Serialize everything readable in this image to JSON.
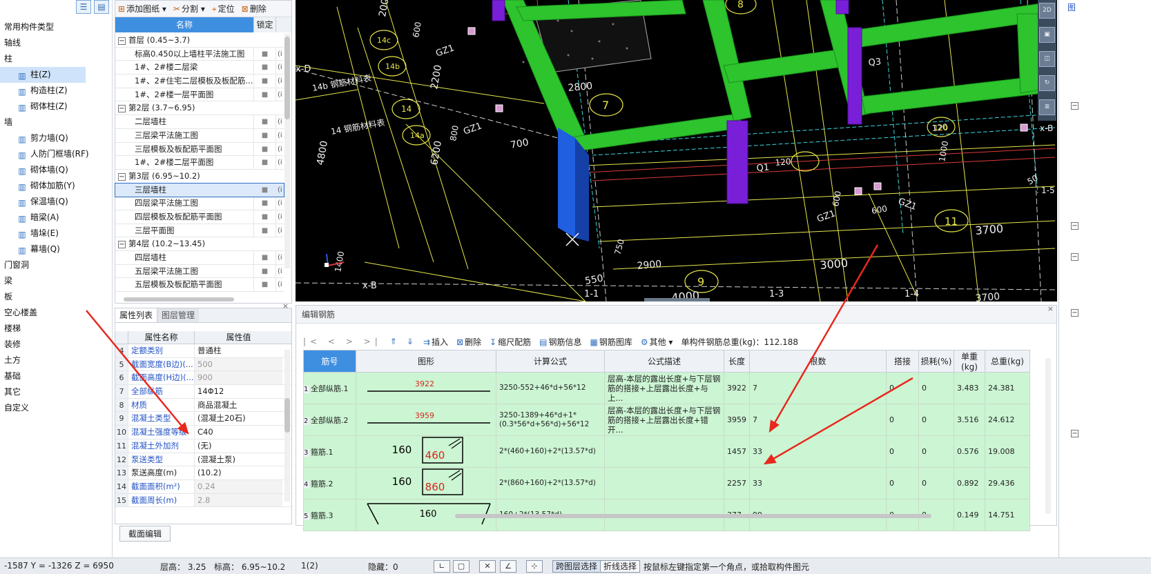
{
  "left_nav": {
    "items": [
      {
        "label": "常用构件类型",
        "type": "cat"
      },
      {
        "label": "轴线",
        "type": "cat"
      },
      {
        "label": "柱",
        "type": "cat"
      },
      {
        "label": "柱(Z)",
        "type": "sub",
        "icon": "column-icon",
        "selected": true
      },
      {
        "label": "构造柱(Z)",
        "type": "sub",
        "icon": "construct-column-icon"
      },
      {
        "label": "砌体柱(Z)",
        "type": "sub",
        "icon": "masonry-column-icon"
      },
      {
        "label": "墙",
        "type": "cat"
      },
      {
        "label": "剪力墙(Q)",
        "type": "sub",
        "icon": "shear-wall-icon"
      },
      {
        "label": "人防门框墙(RF)",
        "type": "sub",
        "icon": "door-frame-wall-icon"
      },
      {
        "label": "砌体墙(Q)",
        "type": "sub",
        "icon": "masonry-wall-icon"
      },
      {
        "label": "砌体加筋(Y)",
        "type": "sub",
        "icon": "masonry-rebar-icon"
      },
      {
        "label": "保温墙(Q)",
        "type": "sub",
        "icon": "insulation-wall-icon"
      },
      {
        "label": "暗梁(A)",
        "type": "sub",
        "icon": "hidden-beam-icon"
      },
      {
        "label": "墙垛(E)",
        "type": "sub",
        "icon": "wall-pier-icon"
      },
      {
        "label": "幕墙(Q)",
        "type": "sub",
        "icon": "curtain-wall-icon"
      },
      {
        "label": "门窗洞",
        "type": "cat"
      },
      {
        "label": "梁",
        "type": "cat"
      },
      {
        "label": "板",
        "type": "cat"
      },
      {
        "label": "空心楼盖",
        "type": "cat"
      },
      {
        "label": "楼梯",
        "type": "cat"
      },
      {
        "label": "装修",
        "type": "cat"
      },
      {
        "label": "土方",
        "type": "cat"
      },
      {
        "label": "基础",
        "type": "cat"
      },
      {
        "label": "其它",
        "type": "cat"
      },
      {
        "label": "自定义",
        "type": "cat"
      }
    ]
  },
  "drawing_panel": {
    "toolbar": {
      "add": "添加图纸",
      "split": "分割",
      "locate": "定位",
      "delete": "删除"
    },
    "headers": {
      "name": "名称",
      "lock": "锁定"
    },
    "rows": [
      {
        "kind": "grp",
        "label": "首层 (0.45~3.7)"
      },
      {
        "kind": "itm",
        "label": "标高0.450以上墙柱平法施工图",
        "ex": "(i"
      },
      {
        "kind": "itm",
        "label": "1#、2#楼二层梁",
        "ex": "(i"
      },
      {
        "kind": "itm",
        "label": "1#、2#住宅二层模板及板配筋...",
        "ex": "(i"
      },
      {
        "kind": "itm",
        "label": "1#、2#楼一层平面图",
        "ex": "(i"
      },
      {
        "kind": "grp",
        "label": "第2层 (3.7~6.95)"
      },
      {
        "kind": "itm",
        "label": "二层墙柱",
        "ex": "(i"
      },
      {
        "kind": "itm",
        "label": "三层梁平法施工图",
        "ex": "(i"
      },
      {
        "kind": "itm",
        "label": "三层模板及板配筋平面图",
        "ex": "(i"
      },
      {
        "kind": "itm",
        "label": "1#、2#楼二层平面图",
        "ex": "(i"
      },
      {
        "kind": "grp",
        "label": "第3层 (6.95~10.2)"
      },
      {
        "kind": "itm",
        "label": "三层墙柱",
        "ex": "(i",
        "selected": true
      },
      {
        "kind": "itm",
        "label": "四层梁平法施工图",
        "ex": "(i"
      },
      {
        "kind": "itm",
        "label": "四层模板及板配筋平面图",
        "ex": "(i"
      },
      {
        "kind": "itm",
        "label": "三层平面图",
        "ex": "(i"
      },
      {
        "kind": "grp",
        "label": "第4层 (10.2~13.45)"
      },
      {
        "kind": "itm",
        "label": "四层墙柱",
        "ex": "(i"
      },
      {
        "kind": "itm",
        "label": "五层梁平法施工图",
        "ex": "(i"
      },
      {
        "kind": "itm",
        "label": "五层模板及板配筋平面图",
        "ex": "(i"
      }
    ]
  },
  "prop_panel": {
    "tabs": [
      "属性列表",
      "图层管理"
    ],
    "headers": {
      "name": "属性名称",
      "value": "属性值"
    },
    "rows": [
      {
        "n": "4",
        "k": "定额类别",
        "v": "普通柱",
        "plain": false
      },
      {
        "n": "5",
        "k": "截面宽度(B边)(...",
        "v": "500",
        "dim": true
      },
      {
        "n": "6",
        "k": "截面高度(H边)(...",
        "v": "900",
        "dim": true
      },
      {
        "n": "7",
        "k": "全部纵筋",
        "v": "14Φ12"
      },
      {
        "n": "8",
        "k": "材质",
        "v": "商品混凝土"
      },
      {
        "n": "9",
        "k": "混凝土类型",
        "v": "(混凝土20石)"
      },
      {
        "n": "10",
        "k": "混凝土强度等级",
        "v": "C40"
      },
      {
        "n": "11",
        "k": "混凝土外加剂",
        "v": "(无)"
      },
      {
        "n": "12",
        "k": "泵送类型",
        "v": "(混凝土泵)"
      },
      {
        "n": "13",
        "k": "泵送高度(m)",
        "v": "(10.2)",
        "plain": true
      },
      {
        "n": "14",
        "k": "截面面积(m²)",
        "v": "0.24",
        "dim": true
      },
      {
        "n": "15",
        "k": "截面周长(m)",
        "v": "2.8",
        "dim": true
      }
    ],
    "footer_button": "截面编辑"
  },
  "cad": {
    "labels": {
      "l200": "200",
      "l600a": "600",
      "l2200": "2200",
      "l2800": "2800",
      "l700": "700",
      "l800": "800",
      "l6200": "6200",
      "l4800": "4800",
      "l1400": "1400",
      "l550": "550",
      "l750": "750",
      "l2900": "2900",
      "l3000": "3000",
      "l4000": "4000",
      "l3700a": "3700",
      "l3700b": "3700",
      "l600b": "600",
      "l600c": "600",
      "l120a": "120",
      "l120b": "120",
      "l50": "50",
      "lQ1": "Q1",
      "lQ3": "Q3",
      "lGZ1a": "GZ1",
      "lGZ1b": "GZ1",
      "lGZ1c": "GZ1",
      "lGZ1d": "GZ1",
      "lxD": "x-D",
      "lxB": "x-B",
      "lxB2": "x-B",
      "l11": "1-1",
      "l13": "1-3",
      "l14": "1-4",
      "l15": "1-5",
      "c14c": "14c",
      "c14b": "14b",
      "c14": "14",
      "c14a": "14a",
      "c7": "7",
      "c8": "8",
      "c9": "9",
      "c11": "11",
      "c120": "120",
      "t14b": "14b 钢筋材料表",
      "t14": "14 钢筋材料表",
      "l1000": "1000"
    },
    "view_tools": [
      "2D",
      "3D",
      "box",
      "rotate",
      "layers"
    ]
  },
  "rebar": {
    "title": "编辑钢筋",
    "toolbar": {
      "nav": "|< < > >|",
      "insert": "插入",
      "delete": "删除",
      "scale": "缩尺配筋",
      "info": "钢筋信息",
      "library": "钢筋图库",
      "other": "其他",
      "total": "单构件钢筋总重(kg)：112.188"
    },
    "headers": [
      "筋号",
      "图形",
      "计算公式",
      "公式描述",
      "长度",
      "根数",
      "搭接",
      "损耗(%)",
      "单重(kg)",
      "总重(kg)"
    ],
    "rows": [
      {
        "i": "1",
        "name": "全部纵筋.1",
        "shape": "line",
        "shape_val": "3922",
        "formula": "3250-552+46*d+56*12",
        "desc": "层高-本层的露出长度+与下层钢筋的搭接+上层露出长度+与上...",
        "len": "3922",
        "count": "7",
        "lap": "0",
        "loss": "0",
        "unit": "3.483",
        "total": "24.381"
      },
      {
        "i": "2",
        "name": "全部纵筋.2",
        "shape": "line",
        "shape_val": "3959",
        "formula": "3250-1389+46*d+1*(0.3*56*d+56*d)+56*12",
        "desc": "层高-本层的露出长度+与下层钢筋的搭接+上层露出长度+错开...",
        "len": "3959",
        "count": "7",
        "lap": "0",
        "loss": "0",
        "unit": "3.516",
        "total": "24.612"
      },
      {
        "i": "3",
        "name": "箍筋.1",
        "shape": "stirrup",
        "shape_a": "160",
        "shape_b": "460",
        "formula": "2*(460+160)+2*(13.57*d)",
        "desc": "",
        "len": "1457",
        "count": "33",
        "lap": "0",
        "loss": "0",
        "unit": "0.576",
        "total": "19.008"
      },
      {
        "i": "4",
        "name": "箍筋.2",
        "shape": "stirrup",
        "shape_a": "160",
        "shape_b": "860",
        "formula": "2*(860+160)+2*(13.57*d)",
        "desc": "",
        "len": "2257",
        "count": "33",
        "lap": "0",
        "loss": "0",
        "unit": "0.892",
        "total": "29.436"
      },
      {
        "i": "5",
        "name": "箍筋.3",
        "shape": "tie",
        "shape_val": "160",
        "formula": "160+2*(13.57*d)",
        "desc": "",
        "len": "377",
        "count": "99",
        "lap": "0",
        "loss": "0",
        "unit": "0.149",
        "total": "14.751"
      }
    ]
  },
  "status": {
    "coords": "-1587 Y = -1326 Z = 6950",
    "floor_height": "层高： 3.25",
    "elevation": "标高： 6.95~10.2",
    "count": "1(2)",
    "hidden": "隐藏：0",
    "cross_layer": "跨图层选择",
    "polyline": "折线选择",
    "hint": "按鼠标左键指定第一个角点，或拾取构件图元"
  },
  "colors": {
    "accent": "#3f8fe0",
    "rebar_row": "#ccf5d3",
    "arrow": "#e8281e",
    "cad_green": "#2dc42d",
    "cad_purple": "#7a1fd8",
    "cad_blue": "#1f5fe0"
  }
}
